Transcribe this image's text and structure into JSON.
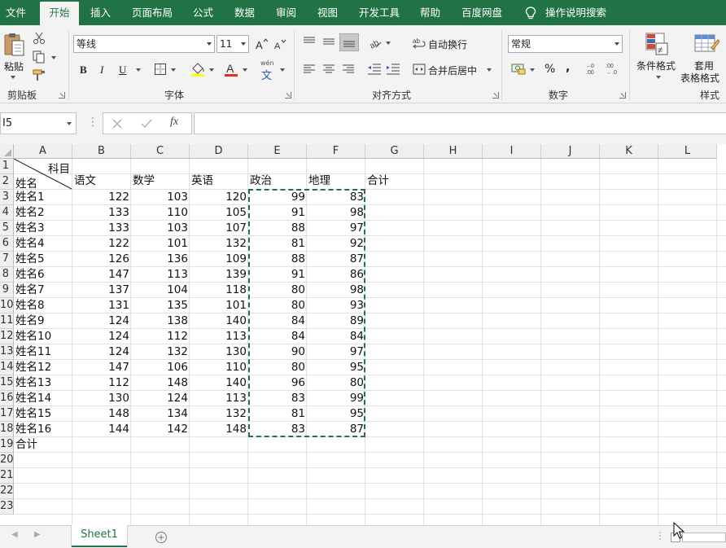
{
  "ribbon_tabs": [
    "文件",
    "开始",
    "插入",
    "页面布局",
    "公式",
    "数据",
    "审阅",
    "视图",
    "开发工具",
    "帮助",
    "百度网盘",
    "操作说明搜索"
  ],
  "active_tab": "开始",
  "groups": {
    "clipboard": {
      "label": "剪贴板",
      "paste": "粘贴"
    },
    "font": {
      "label": "字体",
      "font_name": "等线",
      "font_size": "11",
      "bold": "B",
      "italic": "I",
      "underline": "U",
      "phonetic": "wén"
    },
    "alignment": {
      "label": "对齐方式",
      "wrap_text": "自动换行",
      "merge_center": "合并后居中"
    },
    "number": {
      "label": "数字",
      "format": "常规"
    },
    "styles": {
      "label": "样式",
      "conditional": "条件格式",
      "table_format_1": "套用",
      "table_format_2": "表格格式"
    }
  },
  "formula_bar": {
    "name_box": "I5",
    "fx": "fx",
    "content": ""
  },
  "columns": [
    "A",
    "B",
    "C",
    "D",
    "E",
    "F",
    "G",
    "H",
    "I",
    "J",
    "K",
    "L"
  ],
  "rows": [
    "1",
    "2",
    "3",
    "4",
    "5",
    "6",
    "7",
    "8",
    "9",
    "10",
    "11",
    "12",
    "13",
    "14",
    "15",
    "16",
    "17",
    "18",
    "19",
    "20",
    "21",
    "22",
    "23"
  ],
  "header_row": {
    "diagonal_top": "科目",
    "diagonal_bottom": "姓名",
    "headers": [
      "语文",
      "数学",
      "英语",
      "政治",
      "地理",
      "合计"
    ]
  },
  "data_rows": [
    {
      "name": "姓名1",
      "values": [
        122,
        103,
        120,
        99,
        83
      ]
    },
    {
      "name": "姓名2",
      "values": [
        133,
        110,
        105,
        91,
        98
      ]
    },
    {
      "name": "姓名3",
      "values": [
        133,
        103,
        107,
        88,
        97
      ]
    },
    {
      "name": "姓名4",
      "values": [
        122,
        101,
        132,
        81,
        92
      ]
    },
    {
      "name": "姓名5",
      "values": [
        126,
        136,
        109,
        88,
        87
      ]
    },
    {
      "name": "姓名6",
      "values": [
        147,
        113,
        139,
        91,
        86
      ]
    },
    {
      "name": "姓名7",
      "values": [
        137,
        104,
        118,
        80,
        98
      ]
    },
    {
      "name": "姓名8",
      "values": [
        131,
        135,
        101,
        80,
        93
      ]
    },
    {
      "name": "姓名9",
      "values": [
        124,
        138,
        140,
        84,
        89
      ]
    },
    {
      "name": "姓名10",
      "values": [
        124,
        112,
        113,
        84,
        84
      ]
    },
    {
      "name": "姓名11",
      "values": [
        124,
        132,
        130,
        90,
        97
      ]
    },
    {
      "name": "姓名12",
      "values": [
        147,
        106,
        110,
        80,
        95
      ]
    },
    {
      "name": "姓名13",
      "values": [
        112,
        148,
        140,
        96,
        80
      ]
    },
    {
      "name": "姓名14",
      "values": [
        130,
        124,
        113,
        83,
        99
      ]
    },
    {
      "name": "姓名15",
      "values": [
        148,
        134,
        132,
        81,
        95
      ]
    },
    {
      "name": "姓名16",
      "values": [
        144,
        142,
        148,
        83,
        87
      ]
    }
  ],
  "total_label": "合计",
  "sheet_tabs": [
    "Sheet1"
  ],
  "colors": {
    "accent": "#217346",
    "ribbon_bg": "#f3f3f3",
    "grid_line": "#e1e1e1"
  }
}
